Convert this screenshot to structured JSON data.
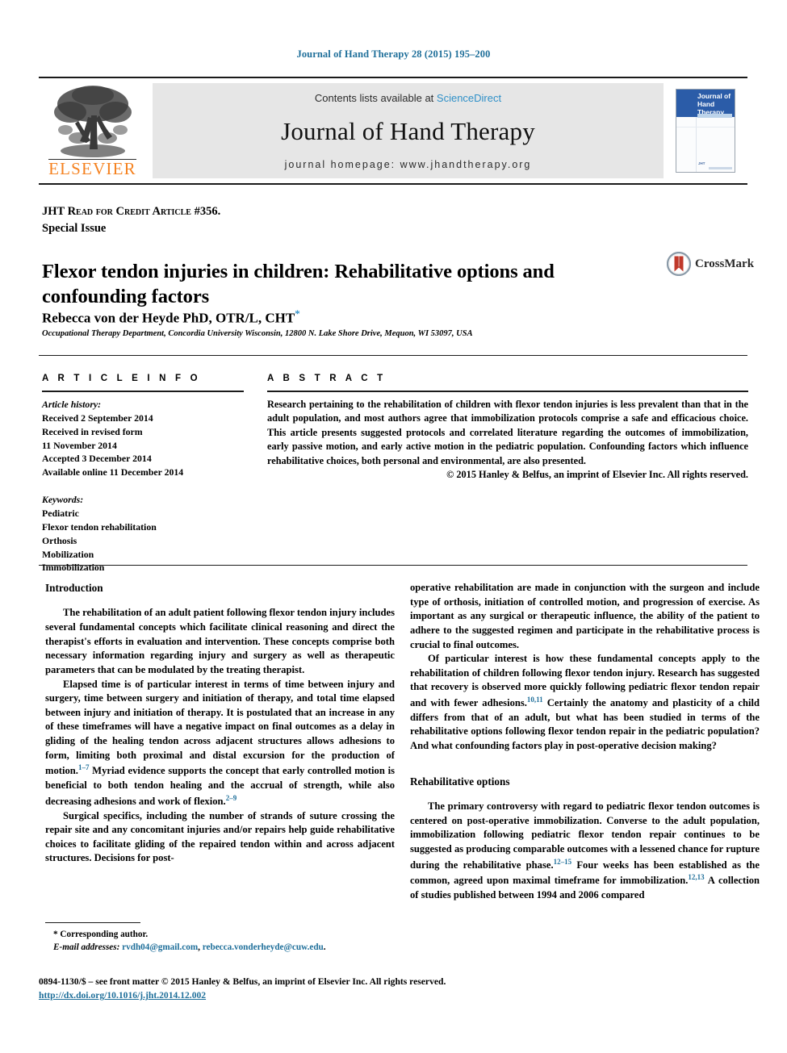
{
  "running_head": "Journal of Hand Therapy 28 (2015) 195–200",
  "masthead": {
    "publisher_name": "ELSEVIER",
    "contents_prefix": "Contents lists available at ",
    "sciencedirect": "ScienceDirect",
    "journal_name": "Journal of Hand Therapy",
    "homepage": "journal homepage: www.jhandtherapy.org",
    "cover_title_line1": "Journal of",
    "cover_title_line2": "Hand Therapy",
    "cover_foot": "JHT"
  },
  "article_label": {
    "line1": "JHT Read for Credit Article #356.",
    "line2": "Special Issue"
  },
  "title": "Flexor tendon injuries in children: Rehabilitative options and confounding factors",
  "authors": "Rebecca von der Heyde PhD, OTR/L, CHT",
  "author_star": "*",
  "affiliation": "Occupational Therapy Department, Concordia University Wisconsin, 12800 N. Lake Shore Drive, Mequon, WI 53097, USA",
  "crossmark": {
    "label": "CrossMark"
  },
  "article_info": {
    "heading": "A R T I C L E   I N F O",
    "history_label": "Article history:",
    "history": [
      "Received 2 September 2014",
      "Received in revised form",
      "11 November 2014",
      "Accepted 3 December 2014",
      "Available online 11 December 2014"
    ],
    "keywords_label": "Keywords:",
    "keywords": [
      "Pediatric",
      "Flexor tendon rehabilitation",
      "Orthosis",
      "Mobilization",
      "Immobilization"
    ]
  },
  "abstract": {
    "heading": "A B S T R A C T",
    "body": "Research pertaining to the rehabilitation of children with flexor tendon injuries is less prevalent than that in the adult population, and most authors agree that immobilization protocols comprise a safe and efficacious choice. This article presents suggested protocols and correlated literature regarding the outcomes of immobilization, early passive motion, and early active motion in the pediatric population. Confounding factors which influence rehabilitative choices, both personal and environmental, are also presented.",
    "copyright": "© 2015 Hanley & Belfus, an imprint of Elsevier Inc. All rights reserved."
  },
  "body": {
    "left": {
      "section_heading": "Introduction",
      "p1": "The rehabilitation of an adult patient following flexor tendon injury includes several fundamental concepts which facilitate clinical reasoning and direct the therapist's efforts in evaluation and intervention. These concepts comprise both necessary information regarding injury and surgery as well as therapeutic parameters that can be modulated by the treating therapist.",
      "p2a": "Elapsed time is of particular interest in terms of time between injury and surgery, time between surgery and initiation of therapy, and total time elapsed between injury and initiation of therapy. It is postulated that an increase in any of these timeframes will have a negative impact on final outcomes as a delay in gliding of the healing tendon across adjacent structures allows adhesions to form, limiting both proximal and distal excursion for the production of motion.",
      "p2_ref1": "1–7",
      "p2b": " Myriad evidence supports the concept that early controlled motion is beneficial to both tendon healing and the accrual of strength, while also decreasing adhesions and work of flexion.",
      "p2_ref2": "2–9",
      "p3": "Surgical specifics, including the number of strands of suture crossing the repair site and any concomitant injuries and/or repairs help guide rehabilitative choices to facilitate gliding of the repaired tendon within and across adjacent structures. Decisions for post-"
    },
    "right": {
      "p1": "operative rehabilitation are made in conjunction with the surgeon and include type of orthosis, initiation of controlled motion, and progression of exercise. As important as any surgical or therapeutic influence, the ability of the patient to adhere to the suggested regimen and participate in the rehabilitative process is crucial to final outcomes.",
      "p2a": "Of particular interest is how these fundamental concepts apply to the rehabilitation of children following flexor tendon injury. Research has suggested that recovery is observed more quickly following pediatric flexor tendon repair and with fewer adhesions.",
      "p2_ref1": "10,11",
      "p2b": " Certainly the anatomy and plasticity of a child differs from that of an adult, but what has been studied in terms of the rehabilitative options following flexor tendon repair in the pediatric population? And what confounding factors play in post-operative decision making?",
      "section_heading": "Rehabilitative options",
      "p3a": "The primary controversy with regard to pediatric flexor tendon outcomes is centered on post-operative immobilization. Converse to the adult population, immobilization following pediatric flexor tendon repair continues to be suggested as producing comparable outcomes with a lessened chance for rupture during the rehabilitative phase.",
      "p3_ref1": "12–15",
      "p3b": " Four weeks has been established as the common, agreed upon maximal timeframe for immobilization.",
      "p3_ref2": "12,13",
      "p3c": " A collection of studies published between 1994 and 2006 compared"
    }
  },
  "footnote": {
    "corresponding": "* Corresponding author.",
    "email_label": "E-mail addresses:",
    "email1": "rvdh04@gmail.com",
    "email_sep": ", ",
    "email2": "rebecca.vonderheyde@cuw.edu",
    "email_end": "."
  },
  "footer": {
    "line1": "0894-1130/$ – see front matter © 2015 Hanley & Belfus, an imprint of Elsevier Inc. All rights reserved.",
    "doi": "http://dx.doi.org/10.1016/j.jht.2014.12.002"
  },
  "colors": {
    "link": "#1f6f9a",
    "sciencedirect": "#2f90c8",
    "elsevier_orange": "#f58220",
    "cover_blue": "#2b5ca8"
  }
}
